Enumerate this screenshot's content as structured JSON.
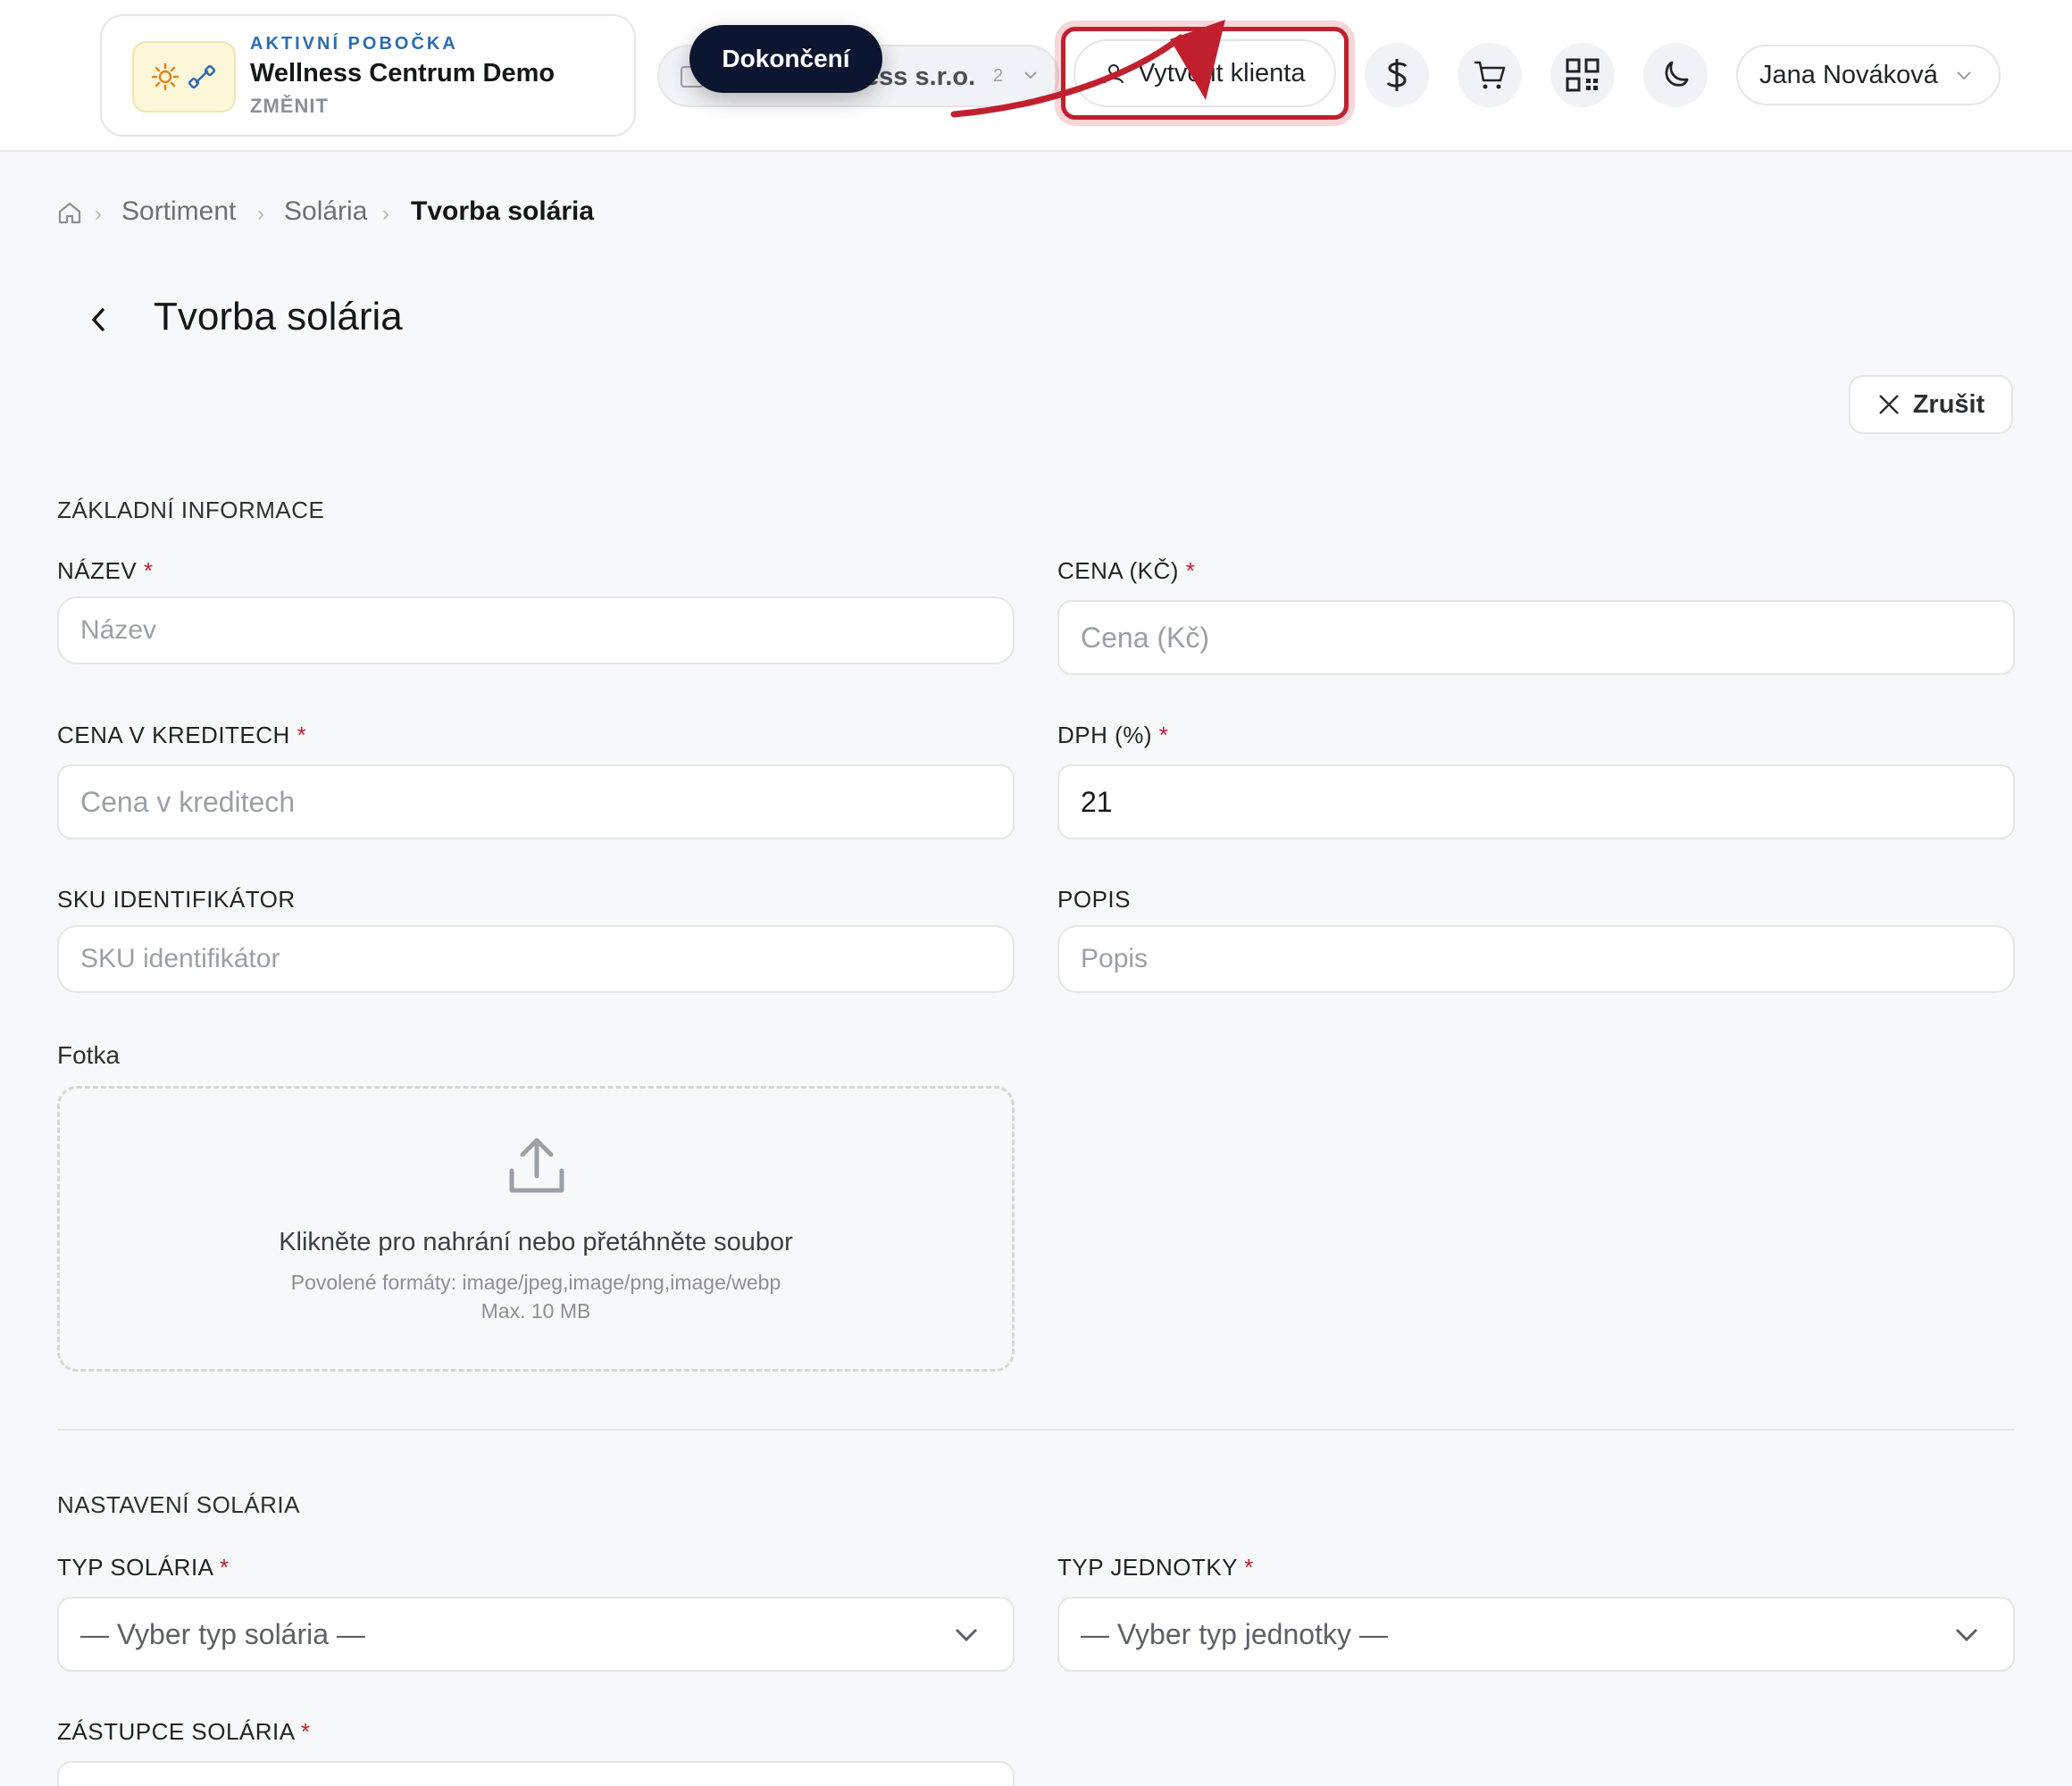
{
  "header": {
    "branch": {
      "eyebrow": "AKTIVNÍ POBOČKA",
      "name": "Wellness Centrum Demo",
      "change": "ZMĚNIT"
    },
    "company": {
      "name": "ess s.r.o.",
      "count": "2"
    },
    "tooltip": "Dokončení",
    "create_client": "Vytvořit klienta",
    "user_name": "Jana Nováková"
  },
  "breadcrumb": {
    "items": [
      "Sortiment",
      "Solária",
      "Tvorba solária"
    ]
  },
  "page": {
    "title": "Tvorba solária",
    "cancel": "Zrušit"
  },
  "basic": {
    "section_title": "ZÁKLADNÍ INFORMACE",
    "name": {
      "label": "NÁZEV",
      "placeholder": "Název"
    },
    "price": {
      "label": "CENA (KČ)",
      "placeholder": "Cena (Kč)"
    },
    "credits": {
      "label": "CENA V KREDITECH",
      "placeholder": "Cena v kreditech"
    },
    "vat": {
      "label": "DPH (%)",
      "value": "21"
    },
    "sku": {
      "label": "SKU IDENTIFIKÁTOR",
      "placeholder": "SKU identifikátor"
    },
    "description": {
      "label": "POPIS",
      "placeholder": "Popis"
    }
  },
  "photo": {
    "label": "Fotka",
    "cta": "Klikněte pro nahrání nebo přetáhněte soubor",
    "formats": "Povolené formáty: image/jpeg,image/png,image/webp",
    "max": "Max. 10 MB"
  },
  "solarium": {
    "section_title": "NASTAVENÍ SOLÁRIA",
    "type": {
      "label": "TYP SOLÁRIA",
      "value": "— Vyber typ solária —"
    },
    "unit": {
      "label": "TYP JEDNOTKY",
      "value": "— Vyber typ jednotky —"
    },
    "representative": {
      "label": "ZÁSTUPCE SOLÁRIA"
    }
  },
  "colors": {
    "accent_red": "#c0202d",
    "brand_blue": "#2b6cb0",
    "tooltip_bg": "#0d1630"
  },
  "icons": [
    "sun-icon",
    "dumbbell-icon",
    "building-icon",
    "chevron-down-icon",
    "user-icon",
    "dollar-icon",
    "cart-icon",
    "qr-code-icon",
    "moon-icon",
    "home-icon",
    "chevron-left-icon",
    "close-icon",
    "upload-icon"
  ]
}
